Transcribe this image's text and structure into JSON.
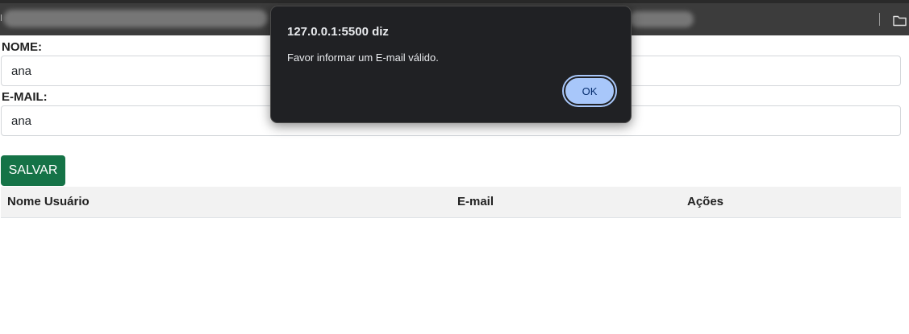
{
  "browser": {
    "folder_icon": "folder-icon"
  },
  "form": {
    "name_label": "NOME:",
    "name_value": "ana",
    "email_label": "E-MAIL:",
    "email_value": "ana",
    "save_label": "SALVAR"
  },
  "table": {
    "columns": [
      "Nome Usuário",
      "E-mail",
      "Ações"
    ]
  },
  "dialog": {
    "title": "127.0.0.1:5500 diz",
    "message": "Favor informar um E-mail válido.",
    "ok_label": "OK"
  },
  "colors": {
    "save_button": "#157347",
    "dialog_background": "#202124",
    "ok_button": "#a8c7fa"
  }
}
